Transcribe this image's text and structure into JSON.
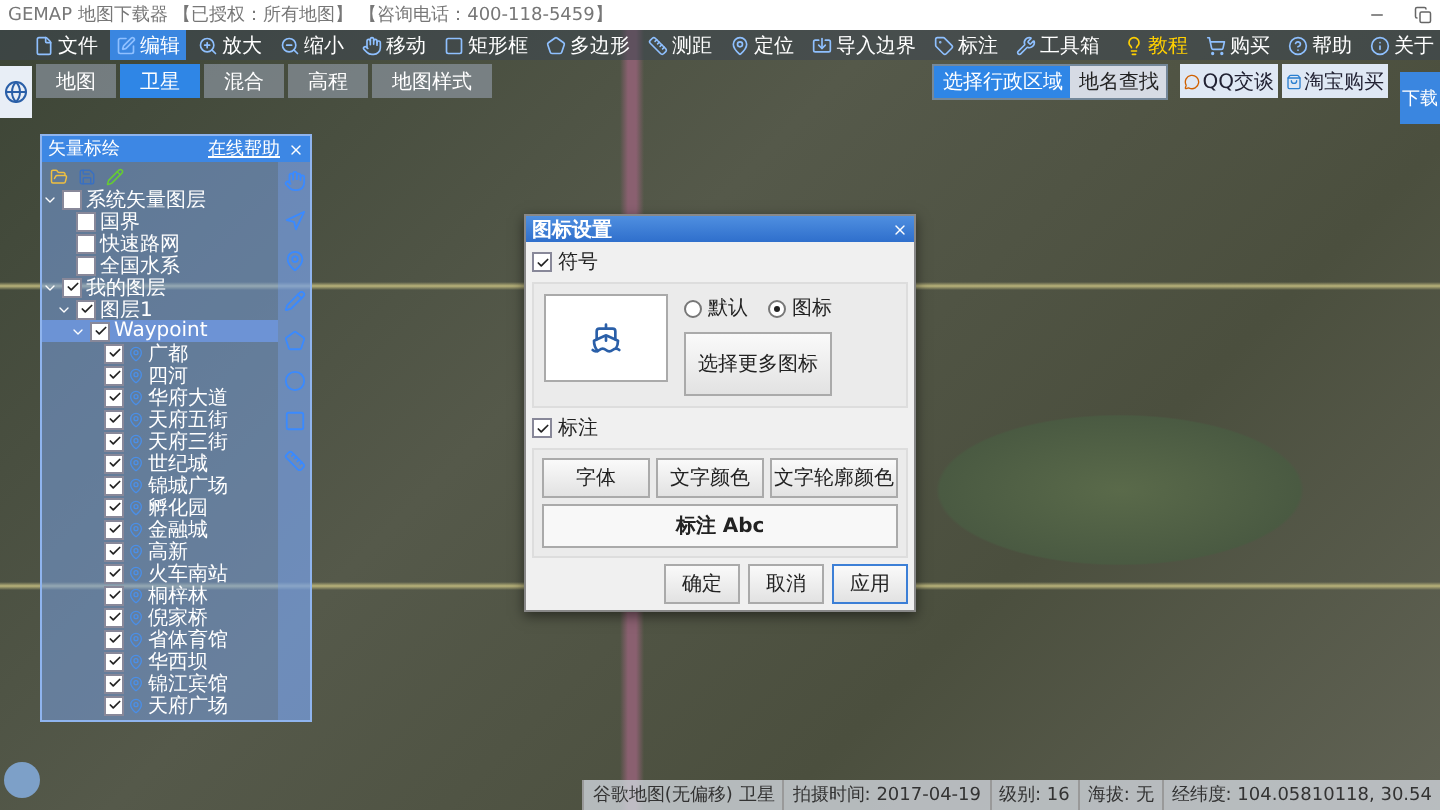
{
  "window": {
    "title": "GEMAP 地图下载器 【已授权：所有地图】 【咨询电话：400-118-5459】"
  },
  "toolbar": [
    {
      "label": "文件",
      "selected": false
    },
    {
      "label": "编辑",
      "selected": true
    },
    {
      "label": "放大",
      "selected": false
    },
    {
      "label": "缩小",
      "selected": false
    },
    {
      "label": "移动",
      "selected": false
    },
    {
      "label": "矩形框",
      "selected": false
    },
    {
      "label": "多边形",
      "selected": false
    },
    {
      "label": "测距",
      "selected": false
    },
    {
      "label": "定位",
      "selected": false
    },
    {
      "label": "导入边界",
      "selected": false
    },
    {
      "label": "标注",
      "selected": false
    },
    {
      "label": "工具箱",
      "selected": false
    }
  ],
  "toolbar_right": [
    {
      "label": "教程",
      "highlight": true
    },
    {
      "label": "购买",
      "highlight": false
    },
    {
      "label": "帮助",
      "highlight": false
    },
    {
      "label": "关于",
      "highlight": false
    }
  ],
  "map_types": [
    {
      "label": "地图",
      "selected": false
    },
    {
      "label": "卫星",
      "selected": true
    },
    {
      "label": "混合",
      "selected": false
    },
    {
      "label": "高程",
      "selected": false
    },
    {
      "label": "地图样式",
      "selected": false
    }
  ],
  "search_tabs": [
    {
      "label": "选择行政区域",
      "selected": true
    },
    {
      "label": "地名查找",
      "selected": false
    }
  ],
  "contact_buttons": [
    "QQ交谈",
    "淘宝购买"
  ],
  "download_button": "下载",
  "vector_panel": {
    "title": "矢量标绘",
    "help_link": "在线帮助",
    "tree": [
      {
        "kind": "folder",
        "label": "系统矢量图层",
        "checked": false,
        "expanded": true,
        "selected": false,
        "children": [
          {
            "kind": "layer",
            "label": "国界",
            "checked": false,
            "selected": false
          },
          {
            "kind": "layer",
            "label": "快速路网",
            "checked": false,
            "selected": false
          },
          {
            "kind": "layer",
            "label": "全国水系",
            "checked": false,
            "selected": false
          }
        ]
      },
      {
        "kind": "folder",
        "label": "我的图层",
        "checked": true,
        "expanded": true,
        "selected": false,
        "children": [
          {
            "kind": "folder",
            "label": "图层1",
            "checked": true,
            "expanded": true,
            "selected": false,
            "children": [
              {
                "kind": "folder",
                "label": "Waypoint",
                "checked": true,
                "expanded": true,
                "selected": true,
                "children": [
                  {
                    "kind": "point",
                    "label": "广都",
                    "checked": true,
                    "selected": false
                  },
                  {
                    "kind": "point",
                    "label": "四河",
                    "checked": true,
                    "selected": false
                  },
                  {
                    "kind": "point",
                    "label": "华府大道",
                    "checked": true,
                    "selected": false
                  },
                  {
                    "kind": "point",
                    "label": "天府五街",
                    "checked": true,
                    "selected": false
                  },
                  {
                    "kind": "point",
                    "label": "天府三街",
                    "checked": true,
                    "selected": false
                  },
                  {
                    "kind": "point",
                    "label": "世纪城",
                    "checked": true,
                    "selected": false
                  },
                  {
                    "kind": "point",
                    "label": "锦城广场",
                    "checked": true,
                    "selected": false
                  },
                  {
                    "kind": "point",
                    "label": "孵化园",
                    "checked": true,
                    "selected": false
                  },
                  {
                    "kind": "point",
                    "label": "金融城",
                    "checked": true,
                    "selected": false
                  },
                  {
                    "kind": "point",
                    "label": "高新",
                    "checked": true,
                    "selected": false
                  },
                  {
                    "kind": "point",
                    "label": "火车南站",
                    "checked": true,
                    "selected": false
                  },
                  {
                    "kind": "point",
                    "label": "桐梓林",
                    "checked": true,
                    "selected": false
                  },
                  {
                    "kind": "point",
                    "label": "倪家桥",
                    "checked": true,
                    "selected": false
                  },
                  {
                    "kind": "point",
                    "label": "省体育馆",
                    "checked": true,
                    "selected": false
                  },
                  {
                    "kind": "point",
                    "label": "华西坝",
                    "checked": true,
                    "selected": false
                  },
                  {
                    "kind": "point",
                    "label": "锦江宾馆",
                    "checked": true,
                    "selected": false
                  },
                  {
                    "kind": "point",
                    "label": "天府广场",
                    "checked": true,
                    "selected": false
                  }
                ]
              }
            ]
          }
        ]
      }
    ]
  },
  "icon_dialog": {
    "title": "图标设置",
    "symbol_section": {
      "label": "符号",
      "checked": true
    },
    "symbol_options": [
      {
        "label": "默认",
        "selected": false
      },
      {
        "label": "图标",
        "selected": true
      }
    ],
    "more_icons_button": "选择更多图标",
    "label_section": {
      "label": "标注",
      "checked": true
    },
    "style_buttons": [
      "字体",
      "文字颜色",
      "文字轮廓颜色"
    ],
    "preview_text": "标注 Abc",
    "actions": [
      {
        "label": "确定",
        "primary": false
      },
      {
        "label": "取消",
        "primary": false
      },
      {
        "label": "应用",
        "primary": true
      }
    ]
  },
  "status_bar": [
    "谷歌地图(无偏移) 卫星",
    "拍摄时间: 2017-04-19",
    "级别: 16",
    "海拔: 无",
    "经纬度: 104.05810118, 30.54"
  ]
}
